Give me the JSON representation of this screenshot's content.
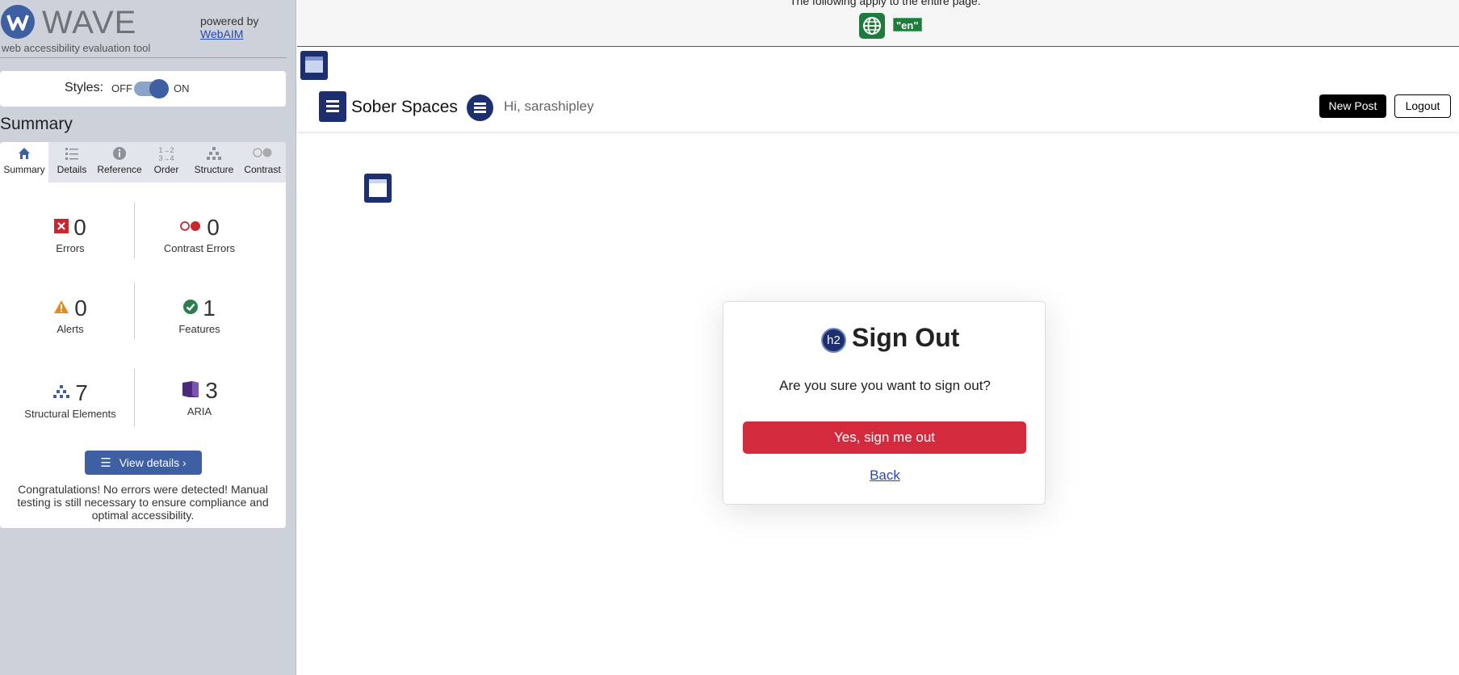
{
  "wave": {
    "logo_text": "WAVE",
    "tagline": "web accessibility evaluation tool",
    "powered_by": "powered by",
    "powered_link": "WebAIM",
    "styles_label": "Styles:",
    "styles_off": "OFF",
    "styles_on": "ON",
    "summary_heading": "Summary",
    "tabs": [
      {
        "label": "Summary",
        "icon": "home-icon",
        "active": true
      },
      {
        "label": "Details",
        "icon": "list-icon"
      },
      {
        "label": "Reference",
        "icon": "info-icon"
      },
      {
        "label": "Order",
        "icon": "order-icon"
      },
      {
        "label": "Structure",
        "icon": "hierarchy-icon"
      },
      {
        "label": "Contrast",
        "icon": "contrast-icon"
      }
    ],
    "stats": {
      "errors": {
        "value": "0",
        "label": "Errors"
      },
      "contrast_errors": {
        "value": "0",
        "label": "Contrast Errors"
      },
      "alerts": {
        "value": "0",
        "label": "Alerts"
      },
      "features": {
        "value": "1",
        "label": "Features"
      },
      "structural": {
        "value": "7",
        "label": "Structural Elements"
      },
      "aria": {
        "value": "3",
        "label": "ARIA"
      }
    },
    "view_details": "View details ›",
    "congrats": "Congratulations! No errors were detected! Manual testing is still necessary to ensure compliance and optimal accessibility."
  },
  "topbar": {
    "text": "The following apply to the entire page:",
    "lang_badge": "\"en\""
  },
  "header": {
    "brand": "Sober Spaces",
    "greeting": "Hi, sarashipley",
    "new_post": "New Post",
    "logout": "Logout"
  },
  "card": {
    "badge": "h2",
    "title": "Sign Out",
    "question": "Are you sure you want to sign out?",
    "confirm": "Yes, sign me out",
    "back": "Back"
  },
  "colors": {
    "wave_blue": "#3f5fa3",
    "navy": "#1d2f6f",
    "danger": "#d42a3e",
    "feature_green": "#1f7a3e"
  }
}
